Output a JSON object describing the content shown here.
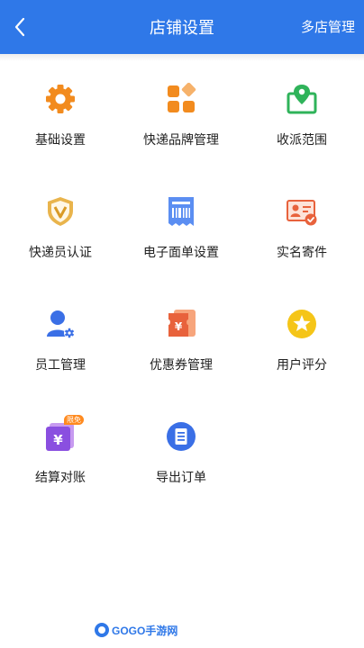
{
  "header": {
    "title": "店铺设置",
    "right_action": "多店管理"
  },
  "grid": {
    "items": [
      {
        "label": "基础设置",
        "icon": "gear-icon"
      },
      {
        "label": "快递品牌管理",
        "icon": "brand-blocks-icon"
      },
      {
        "label": "收派范围",
        "icon": "map-pin-icon"
      },
      {
        "label": "快递员认证",
        "icon": "shield-v-icon"
      },
      {
        "label": "电子面单设置",
        "icon": "barcode-receipt-icon"
      },
      {
        "label": "实名寄件",
        "icon": "id-card-check-icon"
      },
      {
        "label": "员工管理",
        "icon": "staff-gear-icon"
      },
      {
        "label": "优惠券管理",
        "icon": "coupon-icon"
      },
      {
        "label": "用户评分",
        "icon": "star-icon"
      },
      {
        "label": "结算对账",
        "icon": "yen-wallet-icon",
        "badge": "限免"
      },
      {
        "label": "导出订单",
        "icon": "document-list-icon"
      }
    ]
  },
  "watermark": {
    "text": "GOGO手游网"
  },
  "colors": {
    "header": "#2f78e8",
    "orange": "#f28b1e",
    "green": "#2fb35a",
    "blue": "#3a6fe6",
    "yellow": "#f5c518",
    "purple": "#8a4fe0"
  }
}
